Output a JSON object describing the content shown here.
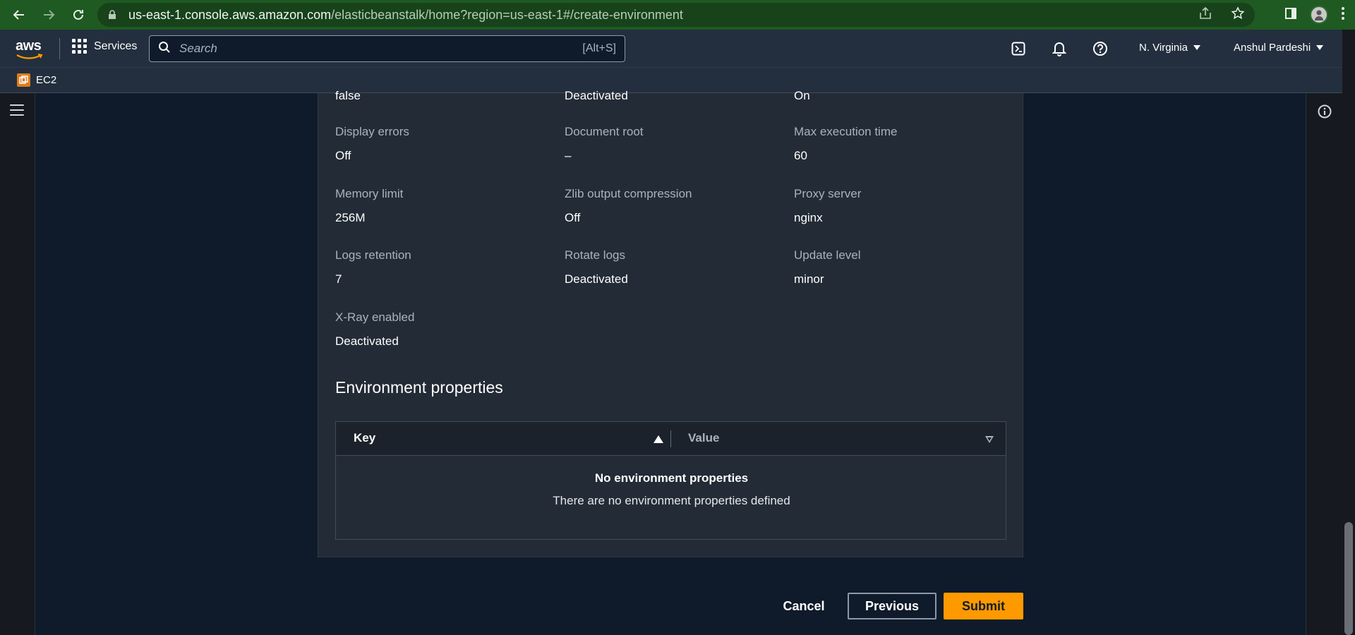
{
  "browser": {
    "url_host": "us-east-1.console.aws.amazon.com",
    "url_path": "/elasticbeanstalk/home?region=us-east-1#/create-environment"
  },
  "aws_nav": {
    "logo": "aws",
    "services_label": "Services",
    "search_placeholder": "Search",
    "search_shortcut": "[Alt+S]",
    "region": "N. Virginia",
    "user": "Anshul Pardeshi"
  },
  "favorites": [
    {
      "label": "EC2"
    }
  ],
  "settings": {
    "top_row_values": [
      "false",
      "Deactivated",
      "On"
    ],
    "rows": [
      [
        {
          "key": "Display errors",
          "value": "Off"
        },
        {
          "key": "Document root",
          "value": "–"
        },
        {
          "key": "Max execution time",
          "value": "60"
        }
      ],
      [
        {
          "key": "Memory limit",
          "value": "256M"
        },
        {
          "key": "Zlib output compression",
          "value": "Off"
        },
        {
          "key": "Proxy server",
          "value": "nginx"
        }
      ],
      [
        {
          "key": "Logs retention",
          "value": "7"
        },
        {
          "key": "Rotate logs",
          "value": "Deactivated"
        },
        {
          "key": "Update level",
          "value": "minor"
        }
      ],
      [
        {
          "key": "X-Ray enabled",
          "value": "Deactivated"
        }
      ]
    ]
  },
  "env_properties": {
    "title": "Environment properties",
    "col_key": "Key",
    "col_value": "Value",
    "empty_title": "No environment properties",
    "empty_subtitle": "There are no environment properties defined"
  },
  "actions": {
    "cancel": "Cancel",
    "previous": "Previous",
    "submit": "Submit"
  },
  "colors": {
    "accent": "#ff9900",
    "nav_bg": "#232f3e",
    "page_bg": "#0f1b2a",
    "browser_bar": "#1e5a22"
  }
}
